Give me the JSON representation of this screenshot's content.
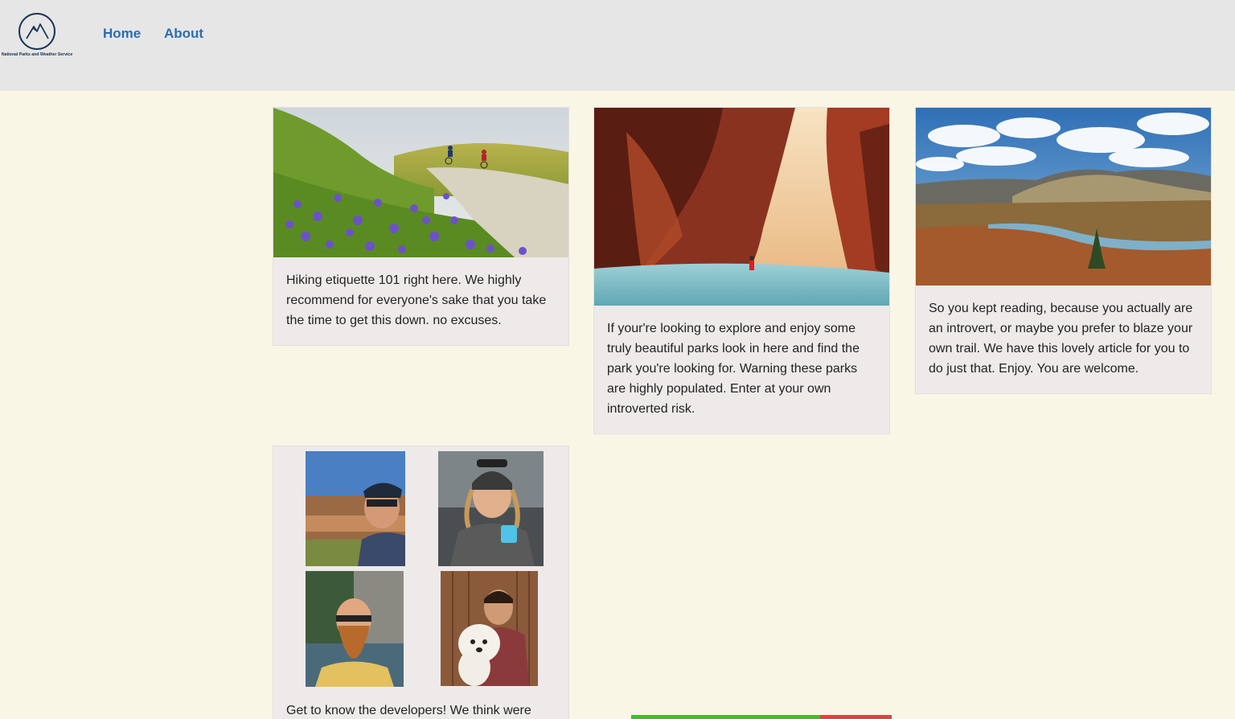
{
  "header": {
    "logo_text": "National Parks and Weather Service",
    "nav": [
      {
        "label": "Home"
      },
      {
        "label": "About"
      }
    ]
  },
  "cards": [
    {
      "image": "wildflower-trail-bikers-photo",
      "text": "Hiking etiquette 101 right here. We highly recommend for everyone's sake that you take the time to get this down. no excuses."
    },
    {
      "image": "red-canyon-narrows-photo",
      "text": "If your're looking to explore and enjoy some truly beautiful parks look in here and find the park you're looking for. Warning these parks are highly populated. Enter at your own introverted risk."
    },
    {
      "image": "river-valley-landscape-photo",
      "text": "So you kept reading, because you actually are an introvert, or maybe you prefer to blaze your own trail. We have this lovely article for you to do just that. Enjoy. You are welcome."
    },
    {
      "image": "developers-photos",
      "text": "Get to know the developers! We think were"
    }
  ],
  "colors": {
    "header_bg": "#e6e6e6",
    "page_bg": "#f9f6e6",
    "nav_link": "#2a6db3",
    "card_bg": "#eeeaea",
    "bar_green": "#3fbf2a",
    "bar_red": "#e24040"
  }
}
